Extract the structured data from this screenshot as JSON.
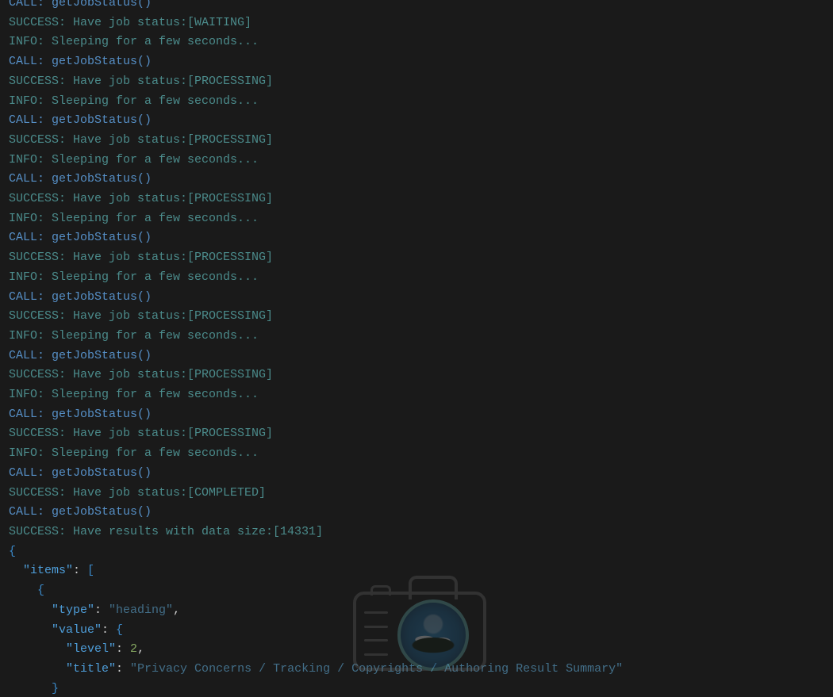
{
  "log": {
    "lines": [
      {
        "cls": "c-call",
        "text": "CALL: getJobStatus()"
      },
      {
        "cls": "c-success",
        "text": "SUCCESS: Have job status:[WAITING]"
      },
      {
        "cls": "c-info",
        "text": "INFO: Sleeping for a few seconds..."
      },
      {
        "cls": "c-call",
        "text": "CALL: getJobStatus()"
      },
      {
        "cls": "c-success",
        "text": "SUCCESS: Have job status:[PROCESSING]"
      },
      {
        "cls": "c-info",
        "text": "INFO: Sleeping for a few seconds..."
      },
      {
        "cls": "c-call",
        "text": "CALL: getJobStatus()"
      },
      {
        "cls": "c-success",
        "text": "SUCCESS: Have job status:[PROCESSING]"
      },
      {
        "cls": "c-info",
        "text": "INFO: Sleeping for a few seconds..."
      },
      {
        "cls": "c-call",
        "text": "CALL: getJobStatus()"
      },
      {
        "cls": "c-success",
        "text": "SUCCESS: Have job status:[PROCESSING]"
      },
      {
        "cls": "c-info",
        "text": "INFO: Sleeping for a few seconds..."
      },
      {
        "cls": "c-call",
        "text": "CALL: getJobStatus()"
      },
      {
        "cls": "c-success",
        "text": "SUCCESS: Have job status:[PROCESSING]"
      },
      {
        "cls": "c-info",
        "text": "INFO: Sleeping for a few seconds..."
      },
      {
        "cls": "c-call",
        "text": "CALL: getJobStatus()"
      },
      {
        "cls": "c-success",
        "text": "SUCCESS: Have job status:[PROCESSING]"
      },
      {
        "cls": "c-info",
        "text": "INFO: Sleeping for a few seconds..."
      },
      {
        "cls": "c-call",
        "text": "CALL: getJobStatus()"
      },
      {
        "cls": "c-success",
        "text": "SUCCESS: Have job status:[PROCESSING]"
      },
      {
        "cls": "c-info",
        "text": "INFO: Sleeping for a few seconds..."
      },
      {
        "cls": "c-call",
        "text": "CALL: getJobStatus()"
      },
      {
        "cls": "c-success",
        "text": "SUCCESS: Have job status:[PROCESSING]"
      },
      {
        "cls": "c-info",
        "text": "INFO: Sleeping for a few seconds..."
      },
      {
        "cls": "c-call",
        "text": "CALL: getJobStatus()"
      },
      {
        "cls": "c-success",
        "text": "SUCCESS: Have job status:[COMPLETED]"
      },
      {
        "cls": "c-call",
        "text": "CALL: getJobStatus()"
      },
      {
        "cls": "c-success",
        "text": "SUCCESS: Have results with data size:[14331]"
      }
    ]
  },
  "json_output": {
    "open_brace": "{",
    "items_key": "\"items\"",
    "items_open": "[",
    "obj_open": "{",
    "type_key": "\"type\"",
    "type_val": "\"heading\"",
    "value_key": "\"value\"",
    "value_open": "{",
    "level_key": "\"level\"",
    "level_val": "2",
    "title_key": "\"title\"",
    "title_val": "\"Privacy Concerns / Tracking / Copyrights / Authoring Result Summary\"",
    "value_close": "}"
  }
}
